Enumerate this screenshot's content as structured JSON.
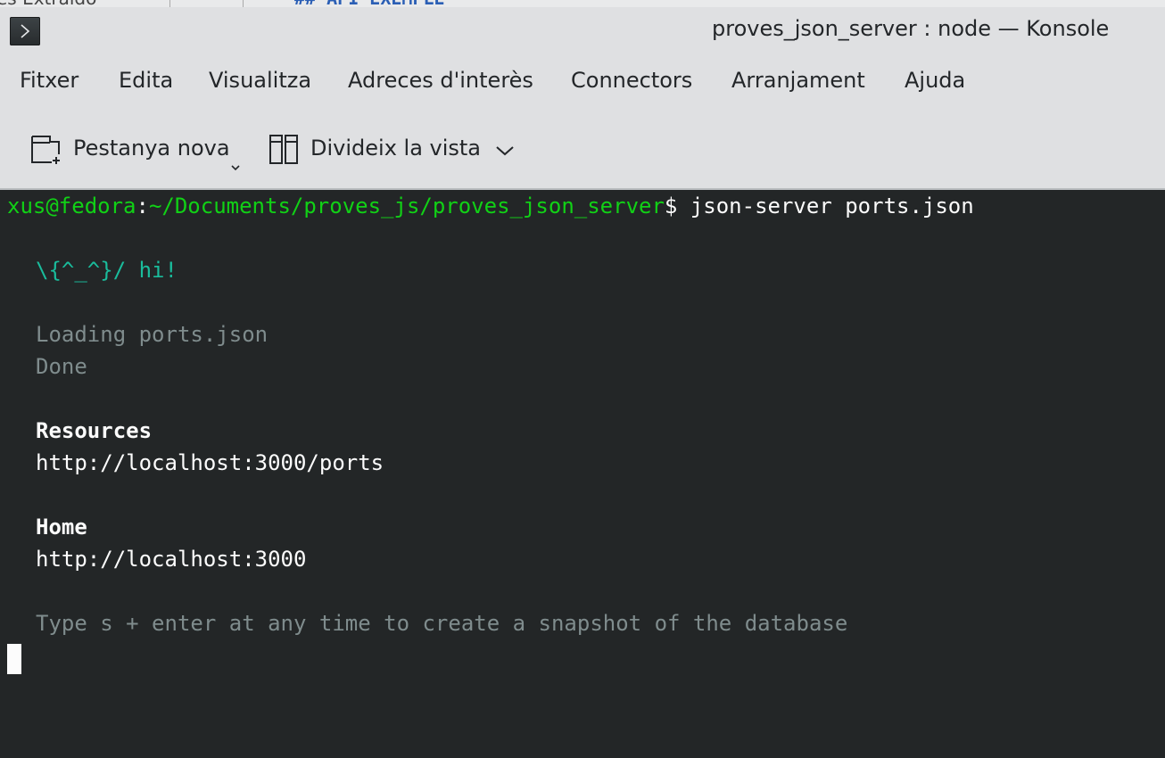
{
  "behind_window": {
    "left_text": "es Extraído",
    "right_text": "## API EXEMPLE"
  },
  "window": {
    "title": "proves_json_server : node — Konsole",
    "app_icon": "konsole-prompt-icon"
  },
  "menu": {
    "items": [
      "Fitxer",
      "Edita",
      "Visualitza",
      "Adreces d'interès",
      "Connectors",
      "Arranjament",
      "Ajuda"
    ]
  },
  "toolbar": {
    "new_tab_label": "Pestanya nova",
    "new_tab_icon": "new-tab-icon",
    "split_view_label": "Divideix la vista",
    "split_view_icon": "split-view-icon"
  },
  "terminal": {
    "prompt_user": "xus@fedora",
    "prompt_sep": ":",
    "prompt_path": "~/Documents/proves_js/proves_json_server",
    "prompt_symbol": "$",
    "command": " json-server ports.json",
    "greeting": "\\{^_^}/ hi!",
    "loading": "Loading ports.json",
    "done": "Done",
    "resources_heading": "Resources",
    "resources_url": "http://localhost:3000/ports",
    "home_heading": "Home",
    "home_url": "http://localhost:3000",
    "snapshot_hint": "Type s + enter at any time to create a snapshot of the database"
  },
  "colors": {
    "terminal_bg": "#232627",
    "chrome_bg": "#dfe0e2",
    "prompt_green": "#11d116",
    "greeting_teal": "#1abc9c",
    "dim_text": "#7f8c8d"
  }
}
